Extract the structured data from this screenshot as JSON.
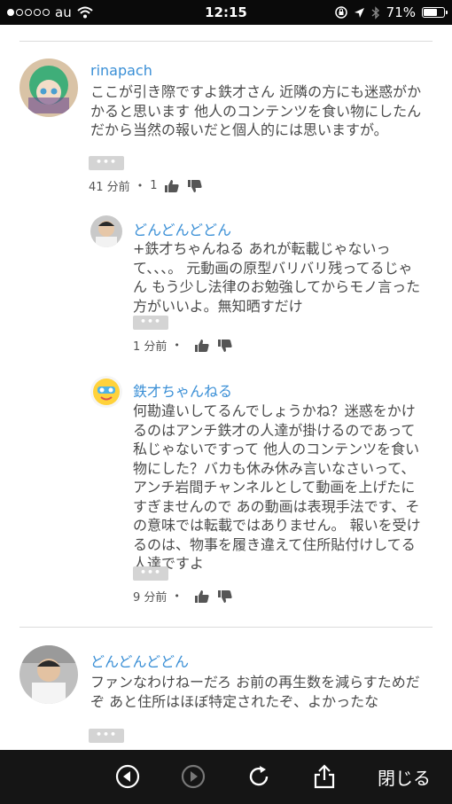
{
  "status_bar": {
    "carrier": "au",
    "time": "12:15",
    "battery_text": "71%",
    "battery_level": 0.71
  },
  "comments": [
    {
      "author": "rinapach",
      "text": "ここが引き際ですよ鉄才さん 近隣の方にも迷惑がかかると思います 他人のコンテンツを食い物にしたんだから当然の報いだと個人的には思いますが。",
      "more": "•••",
      "time": "41 分前",
      "likes": "1"
    },
    {
      "author": "どんどんどどん",
      "text": "+鉄才ちゃんねる あれが転載じゃないって、、、。 元動画の原型バリバリ残ってるじゃん もう少し法律のお勉強してからモノ言った方がいいよ。無知晒すだけ",
      "more": "•••",
      "time": "1 分前"
    },
    {
      "author": "鉄才ちゃんねる",
      "text": "何勘違いしてるんでしょうかね？迷惑をかけるのはアンチ鉄才の人達が掛けるのであって私じゃないですって 他人のコンテンツを食い物にした？バカも休み休み言いなさいって、アンチ岩間チャンネルとして動画を上げたにすぎませんので あの動画は表現手法です、その意味では転載ではありません。 報いを受けるのは、物事を履き違えて住所貼付けしてる人達ですよ",
      "more": "•••",
      "time": "9 分前"
    },
    {
      "author": "どんどんどどん",
      "text": "ファンなわけねーだろ お前の再生数を減らすためだぞ あと住所はほぼ特定されたぞ、よかったな",
      "more": "•••"
    }
  ],
  "meta_separator": "•",
  "toolbar": {
    "close_label": "閉じる"
  },
  "icons": {
    "back": "back-circle-icon",
    "forward": "forward-circle-icon",
    "reload": "reload-icon",
    "share": "share-icon",
    "like": "thumbs-up-icon",
    "dislike": "thumbs-down-icon"
  }
}
